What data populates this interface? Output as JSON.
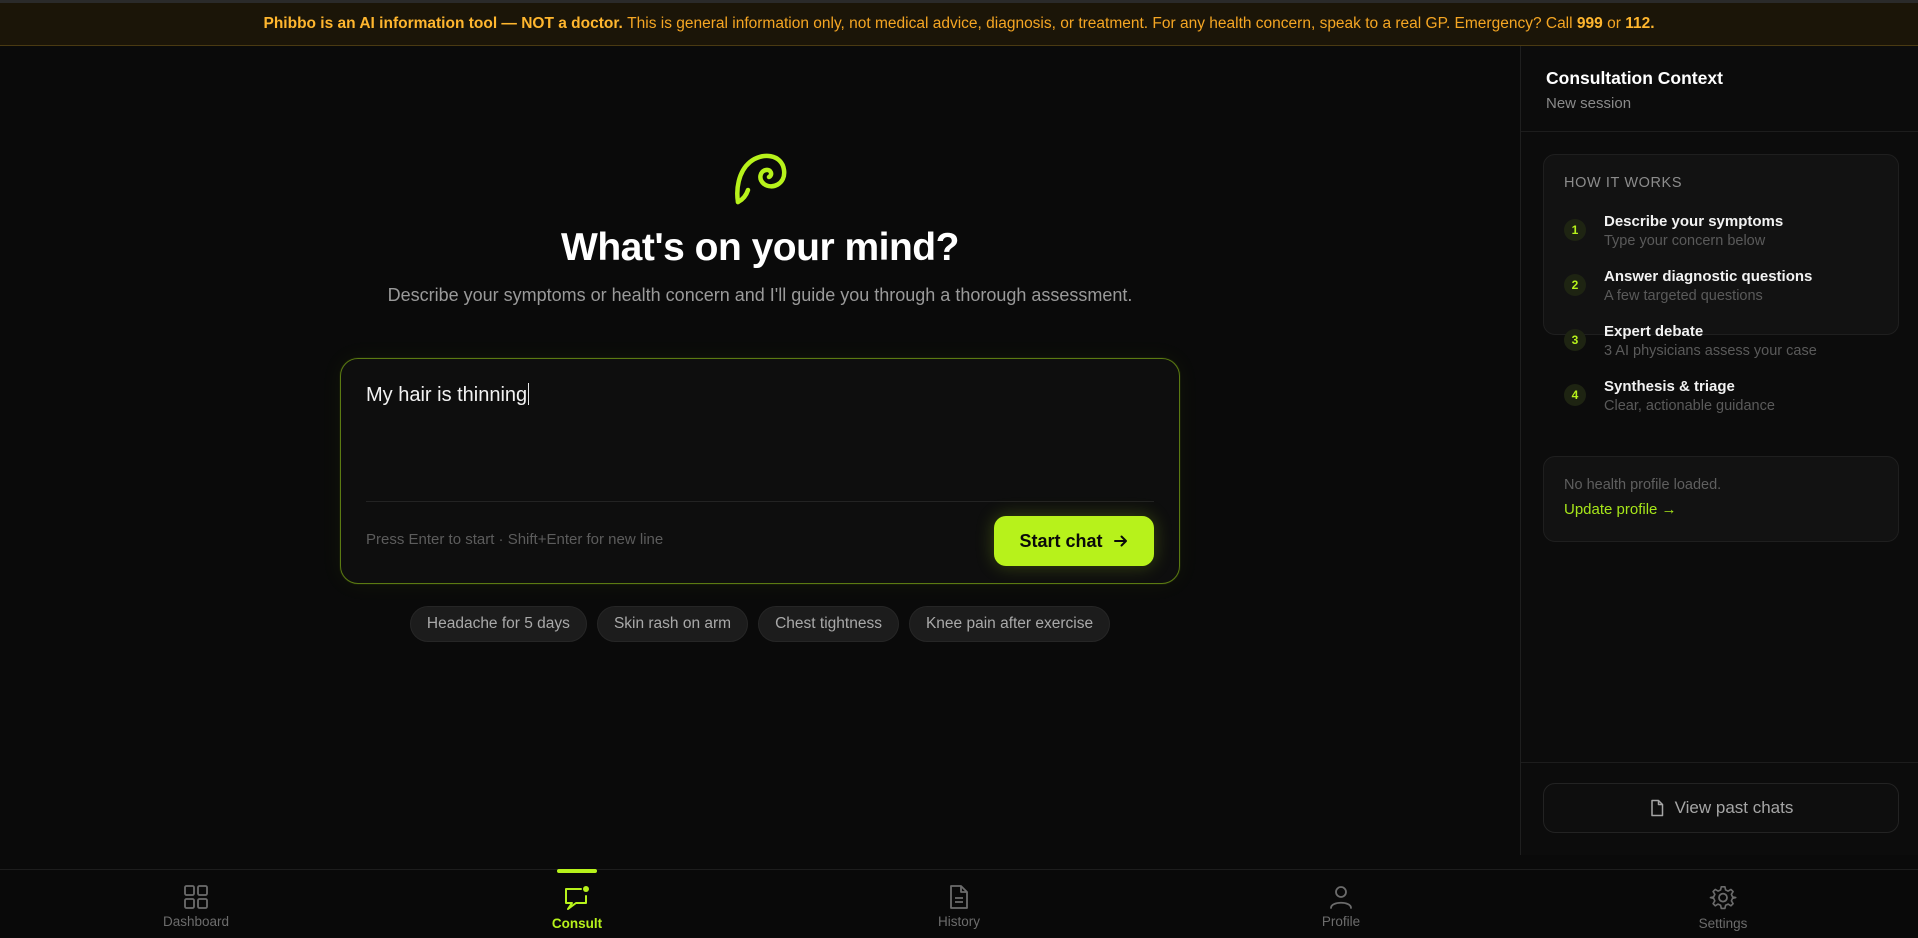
{
  "banner": {
    "bold": "Phibbo is an AI information tool — NOT a doctor.",
    "text_before_numbers": "This is general information only, not medical advice, diagnosis, or treatment. For any health concern, speak to a real GP. Emergency? Call",
    "number_1": "999",
    "or": "or",
    "number_2": "112."
  },
  "hero": {
    "title": "What's on your mind?",
    "subtitle": "Describe your symptoms or health concern and I'll guide you through a thorough assessment."
  },
  "composer": {
    "value": "My hair is thinning",
    "hint": "Press Enter to start · Shift+Enter for new line",
    "start_label": "Start chat"
  },
  "suggestions": [
    "Headache for 5 days",
    "Skin rash on arm",
    "Chest tightness",
    "Knee pain after exercise"
  ],
  "sidebar": {
    "title": "Consultation Context",
    "subtitle": "New session",
    "how_title": "HOW IT WORKS",
    "steps": [
      {
        "num": "1",
        "title": "Describe your symptoms",
        "desc": "Type your concern below"
      },
      {
        "num": "2",
        "title": "Answer diagnostic questions",
        "desc": "A few targeted questions"
      },
      {
        "num": "3",
        "title": "Expert debate",
        "desc": "3 AI physicians assess your case"
      },
      {
        "num": "4",
        "title": "Synthesis & triage",
        "desc": "Clear, actionable guidance"
      }
    ],
    "profile_none": "No health profile loaded.",
    "profile_link": "Update profile →",
    "past_chats": "View past chats"
  },
  "nav": {
    "items": [
      {
        "label": "Dashboard",
        "icon": "grid-icon"
      },
      {
        "label": "Consult",
        "icon": "chat-icon"
      },
      {
        "label": "History",
        "icon": "document-icon"
      },
      {
        "label": "Profile",
        "icon": "user-icon"
      },
      {
        "label": "Settings",
        "icon": "gear-icon"
      }
    ],
    "active": "Consult"
  },
  "colors": {
    "accent": "#b7f21b",
    "banner_text": "#f5a623",
    "background": "#0a0a0a"
  }
}
